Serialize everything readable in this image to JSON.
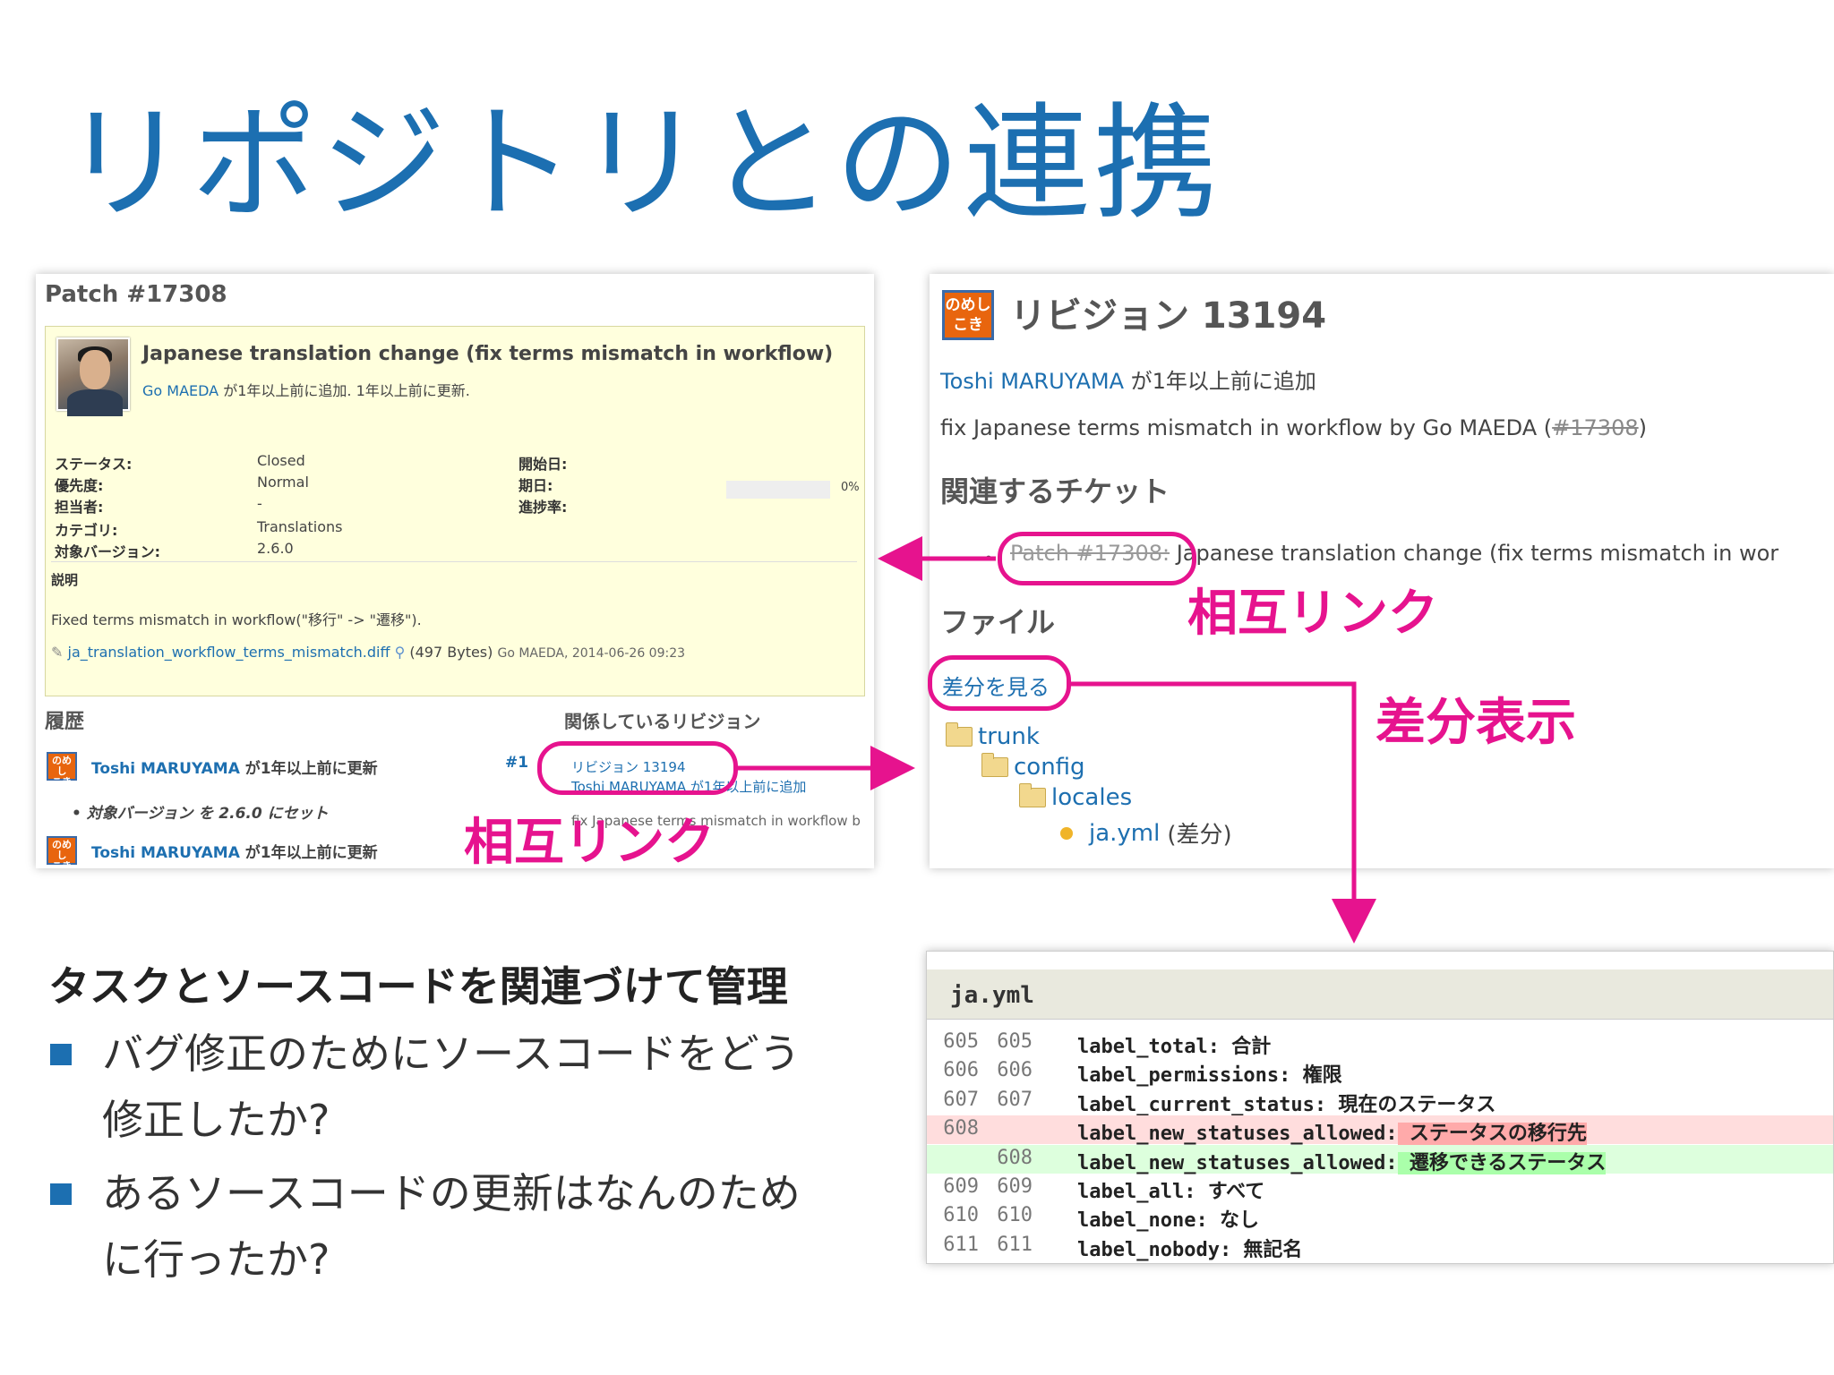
{
  "slide": {
    "title": "リポジトリとの連携",
    "accent_color": "#1c6fb1",
    "annotation_color": "#e6138e"
  },
  "issue": {
    "heading": "Patch #17308",
    "subject": "Japanese translation change (fix terms mismatch in workflow)",
    "author_link": "Go MAEDA",
    "author_suffix": " が1年以上前に追加. 1年以上前に更新.",
    "attributes": [
      {
        "label": "ステータス:",
        "value": "Closed"
      },
      {
        "label": "優先度:",
        "value": "Normal"
      },
      {
        "label": "担当者:",
        "value": "-"
      },
      {
        "label": "カテゴリ:",
        "value": "Translations"
      },
      {
        "label": "対象バージョン:",
        "value": "2.6.0"
      }
    ],
    "right_attributes": [
      {
        "label": "開始日:",
        "value": ""
      },
      {
        "label": "期日:",
        "value": ""
      },
      {
        "label": "進捗率:",
        "value": ""
      }
    ],
    "progress_percent": 0,
    "progress_text": "0%",
    "description_label": "説明",
    "description": "Fixed terms mismatch in workflow(\"移行\" -> \"遷移\").",
    "attachment_name": "ja_translation_workflow_terms_mismatch.diff",
    "attachment_meta": "(497 Bytes)",
    "attachment_by": "Go MAEDA, 2014-06-26 09:23",
    "history_heading": "履歴",
    "related_revisions_heading": "関係しているリビジョン",
    "history": [
      {
        "user": "Toshi MARUYAMA",
        "text": " が1年以上前に更新",
        "anchor": "#1"
      },
      {
        "user": "Toshi MARUYAMA",
        "text": " が1年以上前に更新",
        "anchor": ""
      }
    ],
    "history_detail": "対象バージョン を 2.6.0 にセット",
    "related_revision": {
      "link": "リビジョン 13194",
      "author": "Toshi MARUYAMA が1年以上前に追加",
      "message": "fix Japanese terms mismatch in workflow b"
    },
    "logo_text": "のめし\nこき"
  },
  "revision": {
    "title": "リビジョン 13194",
    "author_link": "Toshi MARUYAMA",
    "author_suffix": " が1年以上前に追加",
    "message_prefix": "fix Japanese terms mismatch in workflow by Go MAEDA (",
    "message_ref": "#17308",
    "message_suffix": ")",
    "related_tickets_heading": "関連するチケット",
    "related_ticket_ref": "Patch #17308:",
    "related_ticket_text": " Japanese translation change (fix terms mismatch in wor",
    "files_heading": "ファイル",
    "view_diff": "差分を見る",
    "tree": [
      "trunk",
      "config",
      "locales"
    ],
    "file": "ja.yml",
    "file_diff": "(差分)",
    "logo_text": "のめし\nこき"
  },
  "diff": {
    "filename": "ja.yml",
    "rows": [
      {
        "old": "605",
        "new": "605",
        "key": "label_total:",
        "val": " 合計",
        "type": "ctx"
      },
      {
        "old": "606",
        "new": "606",
        "key": "label_permissions:",
        "val": " 権限",
        "type": "ctx"
      },
      {
        "old": "607",
        "new": "607",
        "key": "label_current_status:",
        "val": " 現在のステータス",
        "type": "ctx"
      },
      {
        "old": "608",
        "new": "",
        "key": "label_new_statuses_allowed:",
        "val": " ステータスの移行先",
        "type": "del"
      },
      {
        "old": "",
        "new": "608",
        "key": "label_new_statuses_allowed:",
        "val": " 遷移できるステータス",
        "type": "add"
      },
      {
        "old": "609",
        "new": "609",
        "key": "label_all:",
        "val": " すべて",
        "type": "ctx"
      },
      {
        "old": "610",
        "new": "610",
        "key": "label_none:",
        "val": " なし",
        "type": "ctx"
      },
      {
        "old": "611",
        "new": "611",
        "key": "label_nobody:",
        "val": " 無記名",
        "type": "ctx"
      }
    ]
  },
  "callouts": {
    "mutual_link_1": "相互リンク",
    "mutual_link_2": "相互リンク",
    "diff_view": "差分表示"
  },
  "summary": {
    "heading": "タスクとソースコードを関連づけて管理",
    "bullets": [
      {
        "line1": "バグ修正のためにソースコードをどう",
        "line2": "修正したか?"
      },
      {
        "line1": "あるソースコードの更新はなんのため",
        "line2": "に行ったか?"
      }
    ]
  }
}
